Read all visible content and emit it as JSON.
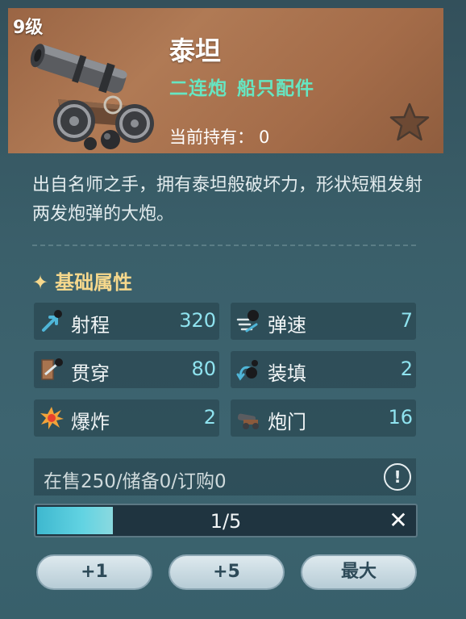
{
  "item": {
    "level": "9级",
    "name": "泰坦",
    "tags": [
      "二连炮",
      "船只配件"
    ],
    "owned_label": "当前持有：",
    "owned_value": "0",
    "description": "出自名师之手，拥有泰坦般破坏力，形状短粗发射两发炮弹的大炮。"
  },
  "section": {
    "sparkle": "✦",
    "title": "基础属性"
  },
  "stats": [
    {
      "label": "射程",
      "value": "320",
      "icon": "range-icon"
    },
    {
      "label": "弹速",
      "value": "7",
      "icon": "projectile-speed-icon"
    },
    {
      "label": "贯穿",
      "value": "80",
      "icon": "penetration-icon"
    },
    {
      "label": "装填",
      "value": "2",
      "icon": "reload-icon"
    },
    {
      "label": "爆炸",
      "value": "2",
      "icon": "explosion-icon"
    },
    {
      "label": "炮门",
      "value": "16",
      "icon": "cannon-ports-icon"
    }
  ],
  "stock": {
    "text": "在售250/储备0/订购0",
    "info_symbol": "!"
  },
  "quantity": {
    "display": "1/5",
    "current": 1,
    "max": 5,
    "close_symbol": "✕"
  },
  "buttons": {
    "plus_one": "+1",
    "plus_five": "+5",
    "max": "最大"
  },
  "colors": {
    "header_bg": "#a46c49",
    "tag_green": "#66e6c2",
    "stat_value": "#8fe3ef",
    "section_gold": "#f6d88c"
  }
}
